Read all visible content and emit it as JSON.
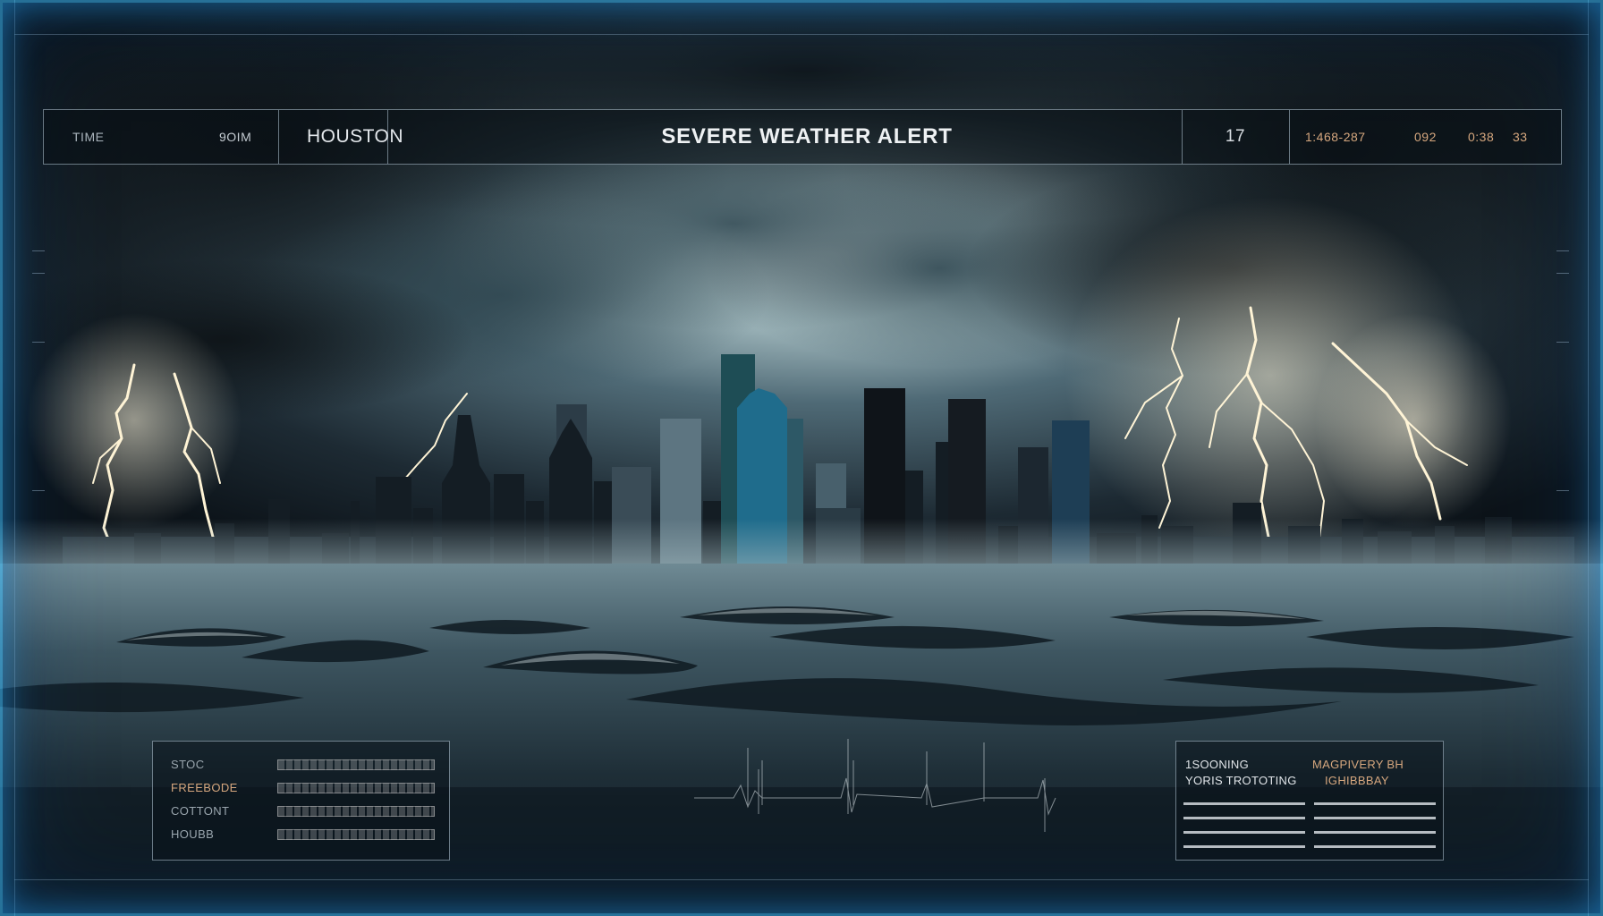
{
  "hud": {
    "time_label": "TIME",
    "time_value": "9OIM",
    "location": "HOUSTON",
    "alert_title": "SEVERE WEATHER ALERT",
    "alert_number": "17",
    "readouts": [
      "1:468-287",
      "092",
      "0:38",
      "33"
    ]
  },
  "status_panel": {
    "rows": [
      {
        "label": "STOC"
      },
      {
        "label": "FREEBODE"
      },
      {
        "label": "COTTONT"
      },
      {
        "label": "HOUBB"
      }
    ]
  },
  "info_panel": {
    "left_lines": [
      "1SOONING",
      "YORIS TROTOTING"
    ],
    "right_lines": [
      "MAGPIVERY   BH",
      "IGHIBBBAY"
    ]
  },
  "colors": {
    "frame_glow": "#3cbeff",
    "readout_accent": "#d6a77e",
    "text_primary": "#eef1f3"
  }
}
